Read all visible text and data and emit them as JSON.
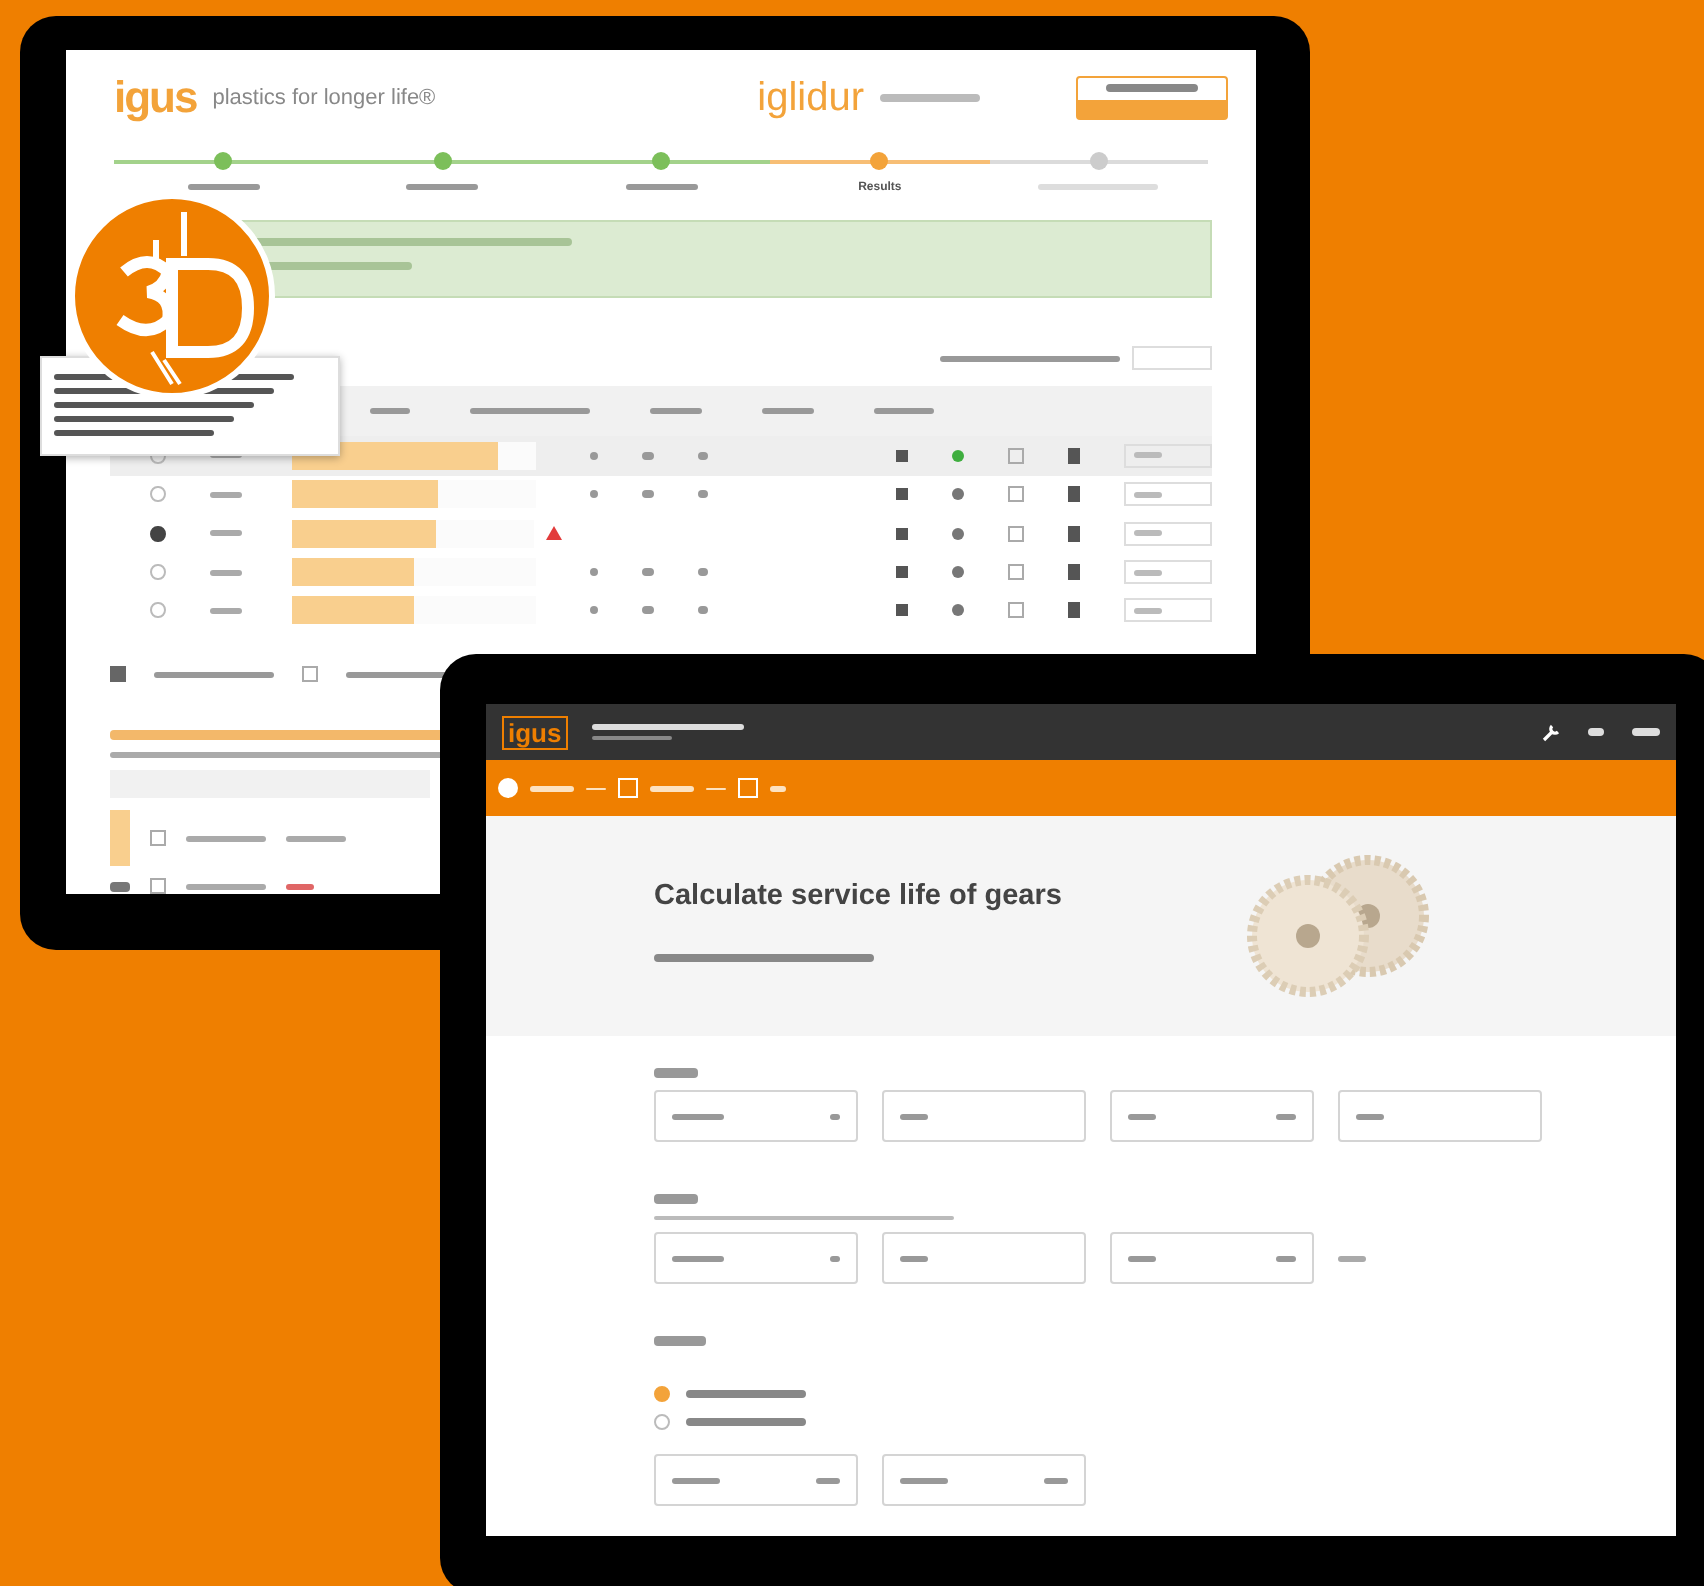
{
  "tablet_1": {
    "header": {
      "logo": "igus",
      "tagline": "plastics for longer life®",
      "product_logo": "iglidur"
    },
    "steps": [
      {
        "completed": true,
        "selected": false
      },
      {
        "completed": true,
        "selected": false
      },
      {
        "completed": true,
        "selected": false
      },
      {
        "completed": false,
        "selected": true,
        "label": "Results"
      },
      {
        "completed": false,
        "selected": false
      }
    ],
    "rows": [
      {
        "selected": false,
        "level": 0.85,
        "flag": false,
        "checked": false
      },
      {
        "selected": false,
        "level": 0.6,
        "flag": false,
        "checked": false
      },
      {
        "selected": true,
        "level": 0.6,
        "flag": true,
        "checked": false
      },
      {
        "selected": false,
        "level": 0.5,
        "flag": false,
        "checked": false
      },
      {
        "selected": false,
        "level": 0.5,
        "flag": false,
        "checked": false
      }
    ],
    "filters": [
      {
        "checked": true
      },
      {
        "checked": false
      }
    ],
    "shaft_rows": [
      {
        "checked": false
      },
      {
        "checked": false
      }
    ]
  },
  "tablet_2": {
    "logo": "igus",
    "title": "Calculate service life of gears",
    "options": [
      {
        "selected": true
      },
      {
        "selected": false
      }
    ]
  }
}
